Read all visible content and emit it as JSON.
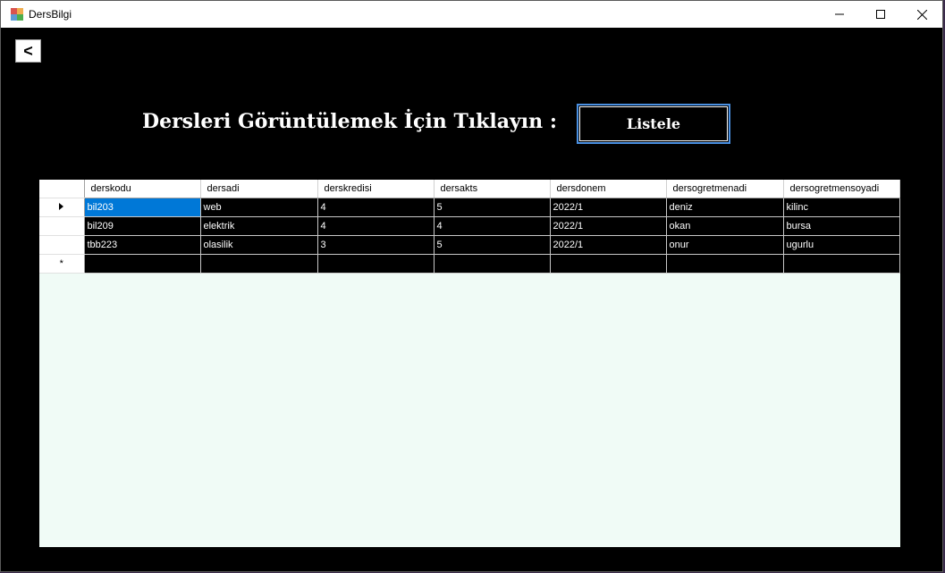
{
  "window": {
    "title": "DersBilgi",
    "minimize_glyph": "—",
    "maximize_glyph": "☐",
    "close_glyph": "✕"
  },
  "back_button": {
    "label": "<"
  },
  "heading": {
    "text": "Dersleri Görüntülemek İçin Tıklayın  :"
  },
  "listele_button": {
    "label": "Listele"
  },
  "grid": {
    "columns": [
      "derskodu",
      "dersadi",
      "derskredisi",
      "dersakts",
      "dersdonem",
      "dersogretmenadi",
      "dersogretmensoyadi"
    ],
    "rows": [
      [
        "bil203",
        "web",
        "4",
        "5",
        "2022/1",
        "deniz",
        "kilinc"
      ],
      [
        "bil209",
        "elektrik",
        "4",
        "4",
        "2022/1",
        "okan",
        "bursa"
      ],
      [
        "tbb223",
        "olasilik",
        "3",
        "5",
        "2022/1",
        "onur",
        "ugurlu"
      ]
    ],
    "selected_row": 0,
    "new_row_glyph": "*",
    "background_color": "#f0fbf6",
    "selection_color": "#0078d7"
  }
}
